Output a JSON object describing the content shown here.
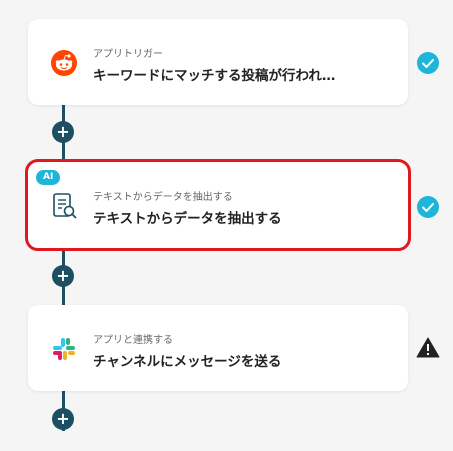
{
  "steps": [
    {
      "subtitle": "アプリトリガー",
      "title": "キーワードにマッチする投稿が行われ…",
      "icon": "reddit-icon",
      "status": "complete"
    },
    {
      "subtitle": "テキストからデータを抽出する",
      "title": "テキストからデータを抽出する",
      "icon": "document-search-icon",
      "status": "complete",
      "badge": "AI"
    },
    {
      "subtitle": "アプリと連携する",
      "title": "チャンネルにメッセージを送る",
      "icon": "slack-icon",
      "status": "warning"
    }
  ],
  "add_button_label": "+",
  "colors": {
    "connector": "#1b4f61",
    "check": "#1fb5d8",
    "selected_border": "#e0191f",
    "warning": "#222222"
  }
}
